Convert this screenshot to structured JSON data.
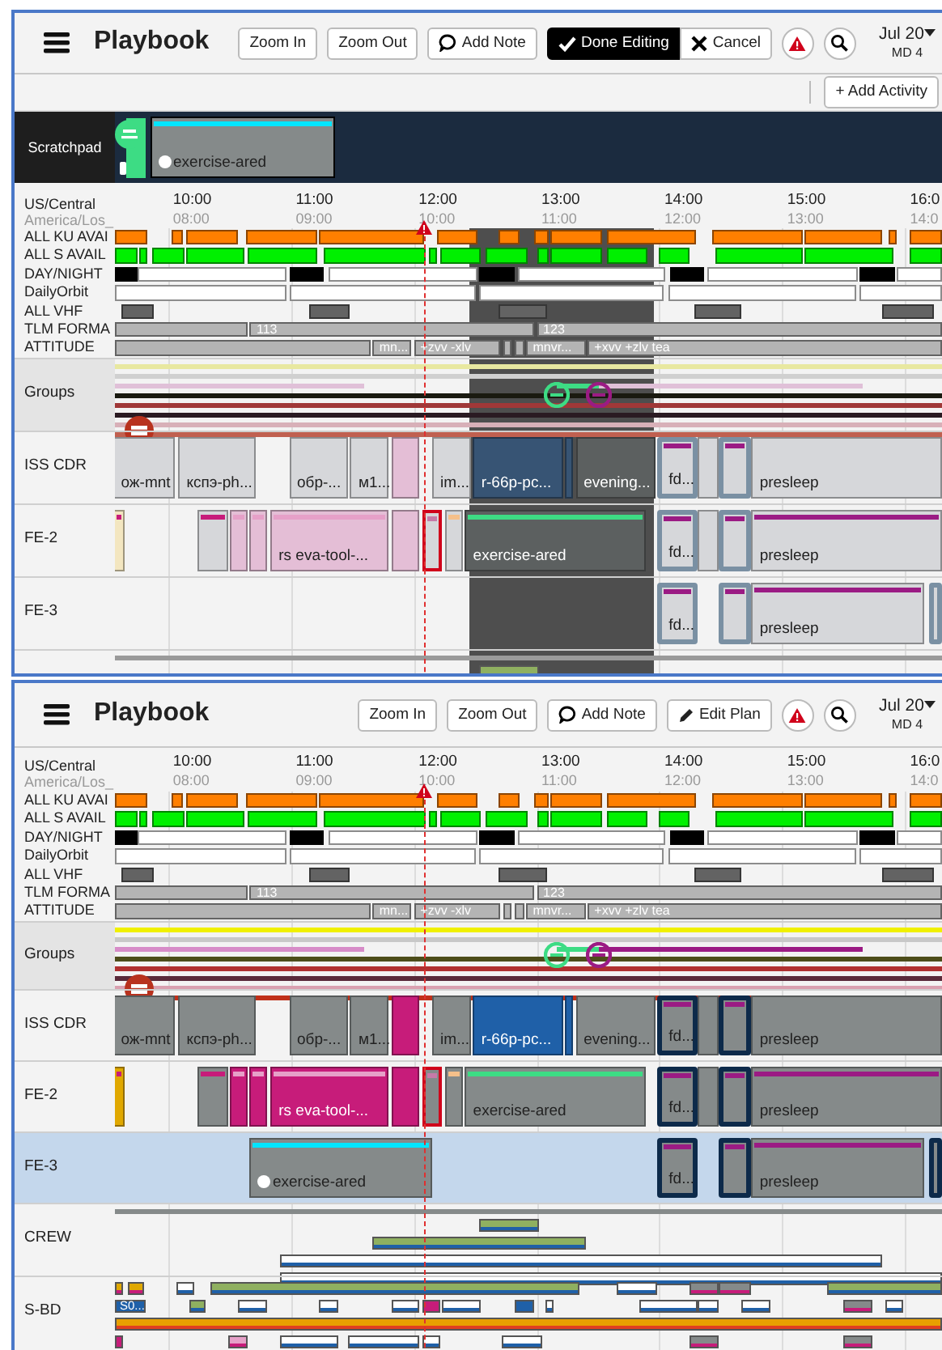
{
  "panels": [
    {
      "editing": true,
      "header": {
        "title": "Playbook",
        "buttons": [
          {
            "kind": "zoom_in",
            "label": "Zoom In"
          },
          {
            "kind": "zoom_out",
            "label": "Zoom Out"
          },
          {
            "kind": "note",
            "label": "Add Note"
          },
          {
            "kind": "done",
            "label": "Done Editing"
          },
          {
            "kind": "cancel",
            "label": "Cancel"
          },
          {
            "kind": "alert"
          },
          {
            "kind": "search"
          }
        ],
        "date": {
          "label": "Jul 20",
          "sub": "MD 4"
        }
      },
      "toolbar": {
        "button": "+ Add Activity"
      },
      "scratchpad": {
        "label": "Scratchpad",
        "handle": {
          "color": "#3ddc84"
        },
        "items": [
          {
            "label": "exercise-ared",
            "color": "#858a8a",
            "stripe": {
              "color": "#00e5ff"
            },
            "dot": true
          }
        ]
      },
      "axis": {
        "zone": "US/Central",
        "zone_local": "America/Los_",
        "ticks": [
          {
            "label": "10:00",
            "sub": "08:00"
          },
          {
            "label": "11:00",
            "sub": "09:00"
          },
          {
            "label": "12:00",
            "sub": "10:00"
          },
          {
            "label": "13:00",
            "sub": "11:00"
          },
          {
            "label": "14:00",
            "sub": "12:00"
          },
          {
            "label": "15:00",
            "sub": "13:00"
          },
          {
            "label": "16:0",
            "sub": "14:0"
          }
        ]
      },
      "tracks": [
        {
          "label": "ALL KU AVAI",
          "segments": [
            {
              "color": "#ff7f00"
            },
            {
              "color": "#ff7f00"
            },
            {
              "color": "#ff7f00"
            },
            {
              "color": "#ff7f00"
            },
            {
              "color": "#ff7f00"
            },
            {
              "color": "#ff7f00"
            },
            {
              "color": "#ff7f00"
            },
            {
              "color": "#ff7f00"
            },
            {
              "color": "#ff7f00"
            },
            {
              "color": "#ff7f00"
            },
            {
              "color": "#ff7f00"
            },
            {
              "color": "#ff7f00"
            },
            {
              "color": "#ff7f00"
            },
            {
              "color": "#ff7f00"
            }
          ]
        },
        {
          "label": "ALL S AVAIL",
          "segments": [
            {
              "color": "#00f000"
            },
            {
              "color": "#00f000"
            },
            {
              "color": "#00f000"
            },
            {
              "color": "#00f000"
            },
            {
              "color": "#00f000"
            },
            {
              "color": "#00f000"
            },
            {
              "color": "#00f000"
            },
            {
              "color": "#00f000"
            },
            {
              "color": "#00f000"
            },
            {
              "color": "#00f000"
            },
            {
              "color": "#00f000"
            },
            {
              "color": "#00f000"
            },
            {
              "color": "#00f000"
            },
            {
              "color": "#00f000"
            },
            {
              "color": "#00f000"
            },
            {
              "color": "#00f000"
            }
          ]
        },
        {
          "label": "DAY/NIGHT",
          "segments": [
            {
              "color": "#000000"
            },
            {
              "color": "#ffffff"
            },
            {
              "color": "#000000"
            },
            {
              "color": "#ffffff"
            },
            {
              "color": "#000000"
            },
            {
              "color": "#ffffff"
            },
            {
              "color": "#000000"
            },
            {
              "color": "#ffffff"
            },
            {
              "color": "#000000"
            },
            {
              "color": "#ffffff"
            }
          ]
        },
        {
          "label": "DailyOrbit",
          "segments": [
            {
              "color": "#ffffff"
            },
            {
              "color": "#ffffff"
            },
            {
              "color": "#ffffff"
            },
            {
              "color": "#ffffff"
            },
            {
              "color": "#ffffff"
            }
          ]
        },
        {
          "label": "ALL VHF",
          "segments": [
            {
              "color": "#636363"
            },
            {
              "color": "#636363"
            },
            {
              "color": "#636363"
            },
            {
              "color": "#636363"
            },
            {
              "color": "#636363"
            }
          ]
        },
        {
          "label": "TLM FORMA",
          "segments": [
            {
              "color": "#b4b4b4"
            },
            {
              "color": "#b4b4b4",
              "label": "113"
            },
            {
              "color": "#b4b4b4",
              "label": "123"
            }
          ]
        },
        {
          "label": "ATTITUDE",
          "segments": [
            {
              "color": "#b4b4b4"
            },
            {
              "color": "#b4b4b4",
              "label": "mn..."
            },
            {
              "color": "#b4b4b4",
              "label": "+zvv -xlv"
            },
            {
              "color": "#b4b4b4"
            },
            {
              "color": "#b4b4b4"
            },
            {
              "color": "#b4b4b4",
              "label": "mnvr..."
            },
            {
              "color": "#b4b4b4",
              "label": "+xvv +zlv tea"
            }
          ]
        }
      ],
      "rows": [
        {
          "label": "Groups",
          "kind": "lanes",
          "selected": false,
          "lanes": [
            {
              "kind": "line",
              "bars": [
                {
                  "color": "#e8e8a0"
                }
              ]
            },
            {
              "kind": "line",
              "bars": [
                {
                  "color": "#d0d0d0"
                }
              ]
            },
            {
              "kind": "line",
              "bars": [
                {
                  "color": "#e0c0d8"
                },
                {
                  "color": "#3ddc84"
                },
                {
                  "color": "#e0c0d8"
                }
              ]
            },
            {
              "kind": "line",
              "bars": [
                {
                  "color": "#1a1a10"
                }
              ]
            },
            {
              "kind": "line",
              "bars": [
                {
                  "color": "#a03838"
                }
              ]
            },
            {
              "kind": "line",
              "bars": [
                {
                  "color": "#2a1a22"
                }
              ]
            },
            {
              "kind": "line",
              "bars": [
                {
                  "color": "#d8b0b8"
                }
              ]
            },
            {
              "kind": "line",
              "bars": [
                {
                  "color": "#c06050"
                }
              ]
            }
          ],
          "markers": [
            {
              "kind": "link",
              "color": "#3ddc84"
            },
            {
              "kind": "link",
              "color": "#9b1b84"
            },
            {
              "kind": "stop",
              "color": "#b8321e"
            }
          ]
        },
        {
          "label": "ISS CDR",
          "kind": "activities",
          "selected": false,
          "activities": [
            {
              "label": "ож-mnt",
              "kind": "block",
              "color": "#d6d7da"
            },
            {
              "label": "кспэ-ph...",
              "kind": "block",
              "color": "#d6d7da"
            },
            {
              "label": "обр-...",
              "kind": "block",
              "color": "#d6d7da"
            },
            {
              "label": "м1...",
              "kind": "block",
              "color": "#d6d7da"
            },
            {
              "kind": "block",
              "color": "#e4bed6"
            },
            {
              "label": "im...",
              "kind": "block",
              "color": "#d6d7da"
            },
            {
              "label": "r-66p-pc...",
              "kind": "block",
              "color": "#375474"
            },
            {
              "kind": "block",
              "color": "#375474"
            },
            {
              "label": "evening...",
              "kind": "block",
              "color": "#5c6060"
            },
            {
              "label": "fd...",
              "kind": "framed",
              "color": "#d6d7da",
              "stripe": {
                "color": "#9b1b84"
              }
            },
            {
              "kind": "block",
              "color": "#d6d7da"
            },
            {
              "kind": "framed",
              "color": "#d6d7da",
              "stripe": {
                "color": "#9b1b84"
              }
            },
            {
              "label": "presleep",
              "kind": "block",
              "color": "#d6d7da"
            }
          ]
        },
        {
          "label": "FE-2",
          "kind": "activities",
          "selected": false,
          "activities": [
            {
              "kind": "block",
              "color": "#f3e6c0",
              "stripe": {
                "color": "#c71c7a"
              }
            },
            {
              "kind": "block",
              "color": "#d6d7da",
              "stripe": {
                "color": "#c71c7a"
              }
            },
            {
              "kind": "block",
              "color": "#e4bed6",
              "stripe": {
                "color": "#e6a0c8"
              }
            },
            {
              "kind": "block",
              "color": "#e4bed6",
              "stripe": {
                "color": "#e6a0c8"
              }
            },
            {
              "label": "rs eva-tool-...",
              "kind": "block",
              "color": "#e4bed6",
              "stripe": {
                "color": "#e6a0c8"
              }
            },
            {
              "kind": "block",
              "color": "#e4bed6"
            },
            {
              "kind": "flagged",
              "color": "#d6d7da",
              "stripe": {
                "color": "#c77aa8"
              }
            },
            {
              "kind": "block",
              "color": "#d6d7da",
              "stripe": {
                "color": "#f5c08a"
              }
            },
            {
              "label": "exercise-ared",
              "kind": "block",
              "color": "#5c6060",
              "stripe": {
                "color": "#3ddc84"
              }
            },
            {
              "label": "fd...",
              "kind": "framed",
              "color": "#d6d7da",
              "stripe": {
                "color": "#9b1b84"
              }
            },
            {
              "kind": "block",
              "color": "#d6d7da"
            },
            {
              "kind": "framed",
              "color": "#d6d7da",
              "stripe": {
                "color": "#9b1b84"
              }
            },
            {
              "label": "presleep",
              "kind": "block",
              "color": "#d6d7da",
              "stripe": {
                "color": "#9b1b84"
              }
            }
          ]
        },
        {
          "label": "FE-3",
          "kind": "activities",
          "selected": false,
          "activities": [
            {
              "label": "fd...",
              "kind": "framed",
              "color": "#d6d7da",
              "stripe": {
                "color": "#9b1b84"
              }
            },
            {
              "kind": "framed",
              "color": "#d6d7da",
              "stripe": {
                "color": "#9b1b84"
              }
            },
            {
              "label": "presleep",
              "kind": "block",
              "color": "#d6d7da",
              "stripe": {
                "color": "#9b1b84"
              }
            },
            {
              "kind": "framed",
              "color": "#d6d7da"
            }
          ]
        },
        {
          "kind": "lanes",
          "selected": false,
          "lanes": [
            {
              "kind": "line",
              "bars": [
                {
                  "color": "#9a9a9a"
                }
              ]
            },
            {
              "kind": "bar",
              "bars": [
                {
                  "color": "#8fb060"
                }
              ]
            }
          ]
        }
      ]
    },
    {
      "editing": false,
      "header": {
        "title": "Playbook",
        "buttons": [
          {
            "kind": "zoom_in",
            "label": "Zoom In"
          },
          {
            "kind": "zoom_out",
            "label": "Zoom Out"
          },
          {
            "kind": "note",
            "label": "Add Note"
          },
          {
            "kind": "edit",
            "label": "Edit Plan"
          },
          {
            "kind": "alert"
          },
          {
            "kind": "search"
          }
        ],
        "date": {
          "label": "Jul 20",
          "sub": "MD 4"
        }
      },
      "axis": {
        "zone": "US/Central",
        "zone_local": "America/Los_",
        "ticks": [
          {
            "label": "10:00",
            "sub": "08:00"
          },
          {
            "label": "11:00",
            "sub": "09:00"
          },
          {
            "label": "12:00",
            "sub": "10:00"
          },
          {
            "label": "13:00",
            "sub": "11:00"
          },
          {
            "label": "14:00",
            "sub": "12:00"
          },
          {
            "label": "15:00",
            "sub": "13:00"
          },
          {
            "label": "16:0",
            "sub": "14:0"
          }
        ]
      },
      "tracks": [
        {
          "label": "ALL KU AVAI",
          "segments": [
            {
              "color": "#ff7f00"
            },
            {
              "color": "#ff7f00"
            },
            {
              "color": "#ff7f00"
            },
            {
              "color": "#ff7f00"
            },
            {
              "color": "#ff7f00"
            },
            {
              "color": "#ff7f00"
            },
            {
              "color": "#ff7f00"
            },
            {
              "color": "#ff7f00"
            },
            {
              "color": "#ff7f00"
            },
            {
              "color": "#ff7f00"
            },
            {
              "color": "#ff7f00"
            },
            {
              "color": "#ff7f00"
            },
            {
              "color": "#ff7f00"
            },
            {
              "color": "#ff7f00"
            }
          ]
        },
        {
          "label": "ALL S AVAIL",
          "segments": [
            {
              "color": "#00f000"
            },
            {
              "color": "#00f000"
            },
            {
              "color": "#00f000"
            },
            {
              "color": "#00f000"
            },
            {
              "color": "#00f000"
            },
            {
              "color": "#00f000"
            },
            {
              "color": "#00f000"
            },
            {
              "color": "#00f000"
            },
            {
              "color": "#00f000"
            },
            {
              "color": "#00f000"
            },
            {
              "color": "#00f000"
            },
            {
              "color": "#00f000"
            },
            {
              "color": "#00f000"
            },
            {
              "color": "#00f000"
            },
            {
              "color": "#00f000"
            },
            {
              "color": "#00f000"
            }
          ]
        },
        {
          "label": "DAY/NIGHT",
          "segments": [
            {
              "color": "#000000"
            },
            {
              "color": "#ffffff"
            },
            {
              "color": "#000000"
            },
            {
              "color": "#ffffff"
            },
            {
              "color": "#000000"
            },
            {
              "color": "#ffffff"
            },
            {
              "color": "#000000"
            },
            {
              "color": "#ffffff"
            },
            {
              "color": "#000000"
            },
            {
              "color": "#ffffff"
            }
          ]
        },
        {
          "label": "DailyOrbit",
          "segments": [
            {
              "color": "#ffffff"
            },
            {
              "color": "#ffffff"
            },
            {
              "color": "#ffffff"
            },
            {
              "color": "#ffffff"
            },
            {
              "color": "#ffffff"
            }
          ]
        },
        {
          "label": "ALL VHF",
          "segments": [
            {
              "color": "#636363"
            },
            {
              "color": "#636363"
            },
            {
              "color": "#636363"
            },
            {
              "color": "#636363"
            },
            {
              "color": "#636363"
            }
          ]
        },
        {
          "label": "TLM FORMA",
          "segments": [
            {
              "color": "#b4b4b4"
            },
            {
              "color": "#b4b4b4",
              "label": "113"
            },
            {
              "color": "#b4b4b4",
              "label": "123"
            }
          ]
        },
        {
          "label": "ATTITUDE",
          "segments": [
            {
              "color": "#b4b4b4"
            },
            {
              "color": "#b4b4b4",
              "label": "mn..."
            },
            {
              "color": "#b4b4b4",
              "label": "+zvv -xlv"
            },
            {
              "color": "#b4b4b4"
            },
            {
              "color": "#b4b4b4"
            },
            {
              "color": "#b4b4b4",
              "label": "mnvr..."
            },
            {
              "color": "#b4b4b4",
              "label": "+xvv +zlv tea"
            }
          ]
        }
      ],
      "rows": [
        {
          "label": "Groups",
          "kind": "lanes",
          "selected": false,
          "lanes": [
            {
              "kind": "line",
              "bars": [
                {
                  "color": "#f0f000"
                }
              ]
            },
            {
              "kind": "line",
              "bars": [
                {
                  "color": "#c8c8c8"
                }
              ]
            },
            {
              "kind": "line",
              "bars": [
                {
                  "color": "#d78cc8"
                },
                {
                  "color": "#3ddc84"
                },
                {
                  "color": "#9b1b84"
                }
              ]
            },
            {
              "kind": "line",
              "bars": [
                {
                  "color": "#4d4d1a"
                }
              ]
            },
            {
              "kind": "line",
              "bars": [
                {
                  "color": "#b03030"
                }
              ]
            },
            {
              "kind": "line",
              "bars": [
                {
                  "color": "#5a2a3a"
                }
              ]
            },
            {
              "kind": "line",
              "bars": [
                {
                  "color": "#d9a0b0"
                }
              ]
            },
            {
              "kind": "line",
              "bars": [
                {
                  "color": "#c0301a"
                }
              ]
            }
          ],
          "markers": [
            {
              "kind": "link",
              "color": "#3ddc84"
            },
            {
              "kind": "link",
              "color": "#9b1b84"
            },
            {
              "kind": "stop",
              "color": "#b8321e"
            }
          ]
        },
        {
          "label": "ISS CDR",
          "kind": "activities",
          "selected": false,
          "activities": [
            {
              "label": "ож-mnt",
              "kind": "block",
              "color": "#858a8a"
            },
            {
              "label": "кспэ-ph...",
              "kind": "block",
              "color": "#858a8a"
            },
            {
              "label": "обр-...",
              "kind": "block",
              "color": "#858a8a"
            },
            {
              "label": "м1...",
              "kind": "block",
              "color": "#858a8a"
            },
            {
              "kind": "block",
              "color": "#c71c7a"
            },
            {
              "label": "im...",
              "kind": "block",
              "color": "#858a8a"
            },
            {
              "label": "r-66p-pc...",
              "kind": "block",
              "color": "#1f60a8"
            },
            {
              "kind": "block",
              "color": "#1f60a8"
            },
            {
              "label": "evening...",
              "kind": "block",
              "color": "#858a8a"
            },
            {
              "label": "fd...",
              "kind": "framed",
              "color": "#858a8a",
              "stripe": {
                "color": "#9b1b84"
              }
            },
            {
              "kind": "block",
              "color": "#858a8a"
            },
            {
              "kind": "framed",
              "color": "#858a8a",
              "stripe": {
                "color": "#9b1b84"
              }
            },
            {
              "label": "presleep",
              "kind": "block",
              "color": "#858a8a"
            }
          ]
        },
        {
          "label": "FE-2",
          "kind": "activities",
          "selected": false,
          "activities": [
            {
              "kind": "block",
              "color": "#e0a800",
              "stripe": {
                "color": "#c71c7a"
              }
            },
            {
              "kind": "block",
              "color": "#858a8a",
              "stripe": {
                "color": "#c71c7a"
              }
            },
            {
              "kind": "block",
              "color": "#c71c7a",
              "stripe": {
                "color": "#e6a0c8"
              }
            },
            {
              "kind": "block",
              "color": "#c71c7a",
              "stripe": {
                "color": "#e6a0c8"
              }
            },
            {
              "label": "rs eva-tool-...",
              "kind": "block",
              "color": "#c71c7a",
              "stripe": {
                "color": "#e6a0c8"
              }
            },
            {
              "kind": "block",
              "color": "#c71c7a"
            },
            {
              "kind": "flagged",
              "color": "#858a8a",
              "stripe": {
                "color": "#c77aa8"
              }
            },
            {
              "kind": "block",
              "color": "#858a8a",
              "stripe": {
                "color": "#f5c08a"
              }
            },
            {
              "label": "exercise-ared",
              "kind": "block",
              "color": "#858a8a",
              "stripe": {
                "color": "#3ddc84"
              }
            },
            {
              "label": "fd...",
              "kind": "framed",
              "color": "#858a8a",
              "stripe": {
                "color": "#9b1b84"
              }
            },
            {
              "kind": "block",
              "color": "#858a8a"
            },
            {
              "kind": "framed",
              "color": "#858a8a",
              "stripe": {
                "color": "#9b1b84"
              }
            },
            {
              "label": "presleep",
              "kind": "block",
              "color": "#858a8a",
              "stripe": {
                "color": "#9b1b84"
              }
            }
          ]
        },
        {
          "label": "FE-3",
          "kind": "activities",
          "selected": true,
          "activities": [
            {
              "label": "exercise-ared",
              "kind": "block",
              "color": "#858a8a",
              "stripe": {
                "color": "#00e5ff"
              },
              "dot": true
            },
            {
              "label": "fd...",
              "kind": "framed",
              "color": "#858a8a",
              "stripe": {
                "color": "#9b1b84"
              }
            },
            {
              "kind": "framed",
              "color": "#858a8a",
              "stripe": {
                "color": "#9b1b84"
              }
            },
            {
              "label": "presleep",
              "kind": "block",
              "color": "#858a8a",
              "stripe": {
                "color": "#9b1b84"
              }
            },
            {
              "kind": "framed",
              "color": "#858a8a"
            }
          ]
        },
        {
          "label": "CREW",
          "kind": "lanes",
          "selected": false,
          "lanes": [
            {
              "kind": "line",
              "bars": [
                {
                  "color": "#858a8a"
                }
              ]
            },
            {
              "kind": "bar",
              "bars": [
                {
                  "color": "#8fb060",
                  "stripe": {
                    "color": "#1f60a8"
                  }
                }
              ]
            },
            {
              "kind": "bar",
              "bars": [
                {
                  "color": "#8fb060",
                  "stripe": {
                    "color": "#1f60a8"
                  }
                }
              ]
            },
            {
              "kind": "bar",
              "bars": [
                {
                  "color": "#ffffff",
                  "stripe": {
                    "color": "#1f60a8"
                  }
                }
              ]
            },
            {
              "kind": "bar",
              "bars": [
                {
                  "color": "#ffffff",
                  "stripe": {
                    "color": "#1f60a8"
                  }
                }
              ]
            }
          ]
        },
        {
          "label": "S-BD",
          "kind": "lanes",
          "selected": false,
          "lanes": [
            {
              "kind": "bar",
              "bars": [
                {
                  "color": "#e0a800",
                  "stripe": {
                    "color": "#c71c7a"
                  }
                },
                {
                  "color": "#e0a800",
                  "stripe": {
                    "color": "#c71c7a"
                  }
                },
                {
                  "color": "#ffffff",
                  "stripe": {
                    "color": "#1f60a8"
                  }
                },
                {
                  "color": "#8fb060",
                  "stripe": {
                    "color": "#1f60a8"
                  }
                },
                {
                  "color": "#ffffff",
                  "stripe": {
                    "color": "#1f60a8"
                  }
                },
                {
                  "color": "#858a8a",
                  "stripe": {
                    "color": "#c71c7a"
                  }
                },
                {
                  "color": "#858a8a",
                  "stripe": {
                    "color": "#c71c7a"
                  }
                },
                {
                  "color": "#8fb060",
                  "stripe": {
                    "color": "#1f60a8"
                  }
                }
              ]
            },
            {
              "kind": "bar",
              "bars": [
                {
                  "color": "#1f60a8",
                  "label": "S0..."
                },
                {
                  "color": "#8fb060",
                  "stripe": {
                    "color": "#1f60a8"
                  }
                },
                {
                  "color": "#ffffff",
                  "stripe": {
                    "color": "#1f60a8"
                  }
                },
                {
                  "color": "#ffffff",
                  "stripe": {
                    "color": "#1f60a8"
                  }
                },
                {
                  "color": "#ffffff",
                  "stripe": {
                    "color": "#1f60a8"
                  }
                },
                {
                  "color": "#c71c7a"
                },
                {
                  "color": "#ffffff",
                  "stripe": {
                    "color": "#1f60a8"
                  }
                },
                {
                  "color": "#1f60a8"
                },
                {
                  "color": "#ffffff",
                  "stripe": {
                    "color": "#1f60a8"
                  }
                },
                {
                  "color": "#ffffff",
                  "stripe": {
                    "color": "#1f60a8"
                  }
                },
                {
                  "color": "#ffffff",
                  "stripe": {
                    "color": "#1f60a8"
                  }
                },
                {
                  "color": "#ffffff",
                  "stripe": {
                    "color": "#1f60a8"
                  }
                },
                {
                  "color": "#858a8a",
                  "stripe": {
                    "color": "#c71c7a"
                  }
                },
                {
                  "color": "#ffffff",
                  "stripe": {
                    "color": "#1f60a8"
                  }
                }
              ]
            },
            {
              "kind": "bar",
              "bars": [
                {
                  "color": "#e8a000",
                  "stripe": {
                    "color": "#e04020"
                  }
                }
              ]
            },
            {
              "kind": "bar",
              "bars": [
                {
                  "color": "#c71c7a"
                },
                {
                  "color": "#e6a0c8",
                  "stripe": {
                    "color": "#c71c7a"
                  }
                },
                {
                  "color": "#ffffff",
                  "stripe": {
                    "color": "#1f60a8"
                  }
                },
                {
                  "color": "#ffffff",
                  "stripe": {
                    "color": "#1f60a8"
                  }
                },
                {
                  "color": "#ffffff",
                  "stripe": {
                    "color": "#1f60a8"
                  }
                },
                {
                  "color": "#ffffff",
                  "stripe": {
                    "color": "#1f60a8"
                  }
                },
                {
                  "color": "#858a8a",
                  "stripe": {
                    "color": "#c71c7a"
                  }
                },
                {
                  "color": "#858a8a",
                  "stripe": {
                    "color": "#c71c7a"
                  }
                }
              ]
            }
          ]
        }
      ]
    }
  ]
}
